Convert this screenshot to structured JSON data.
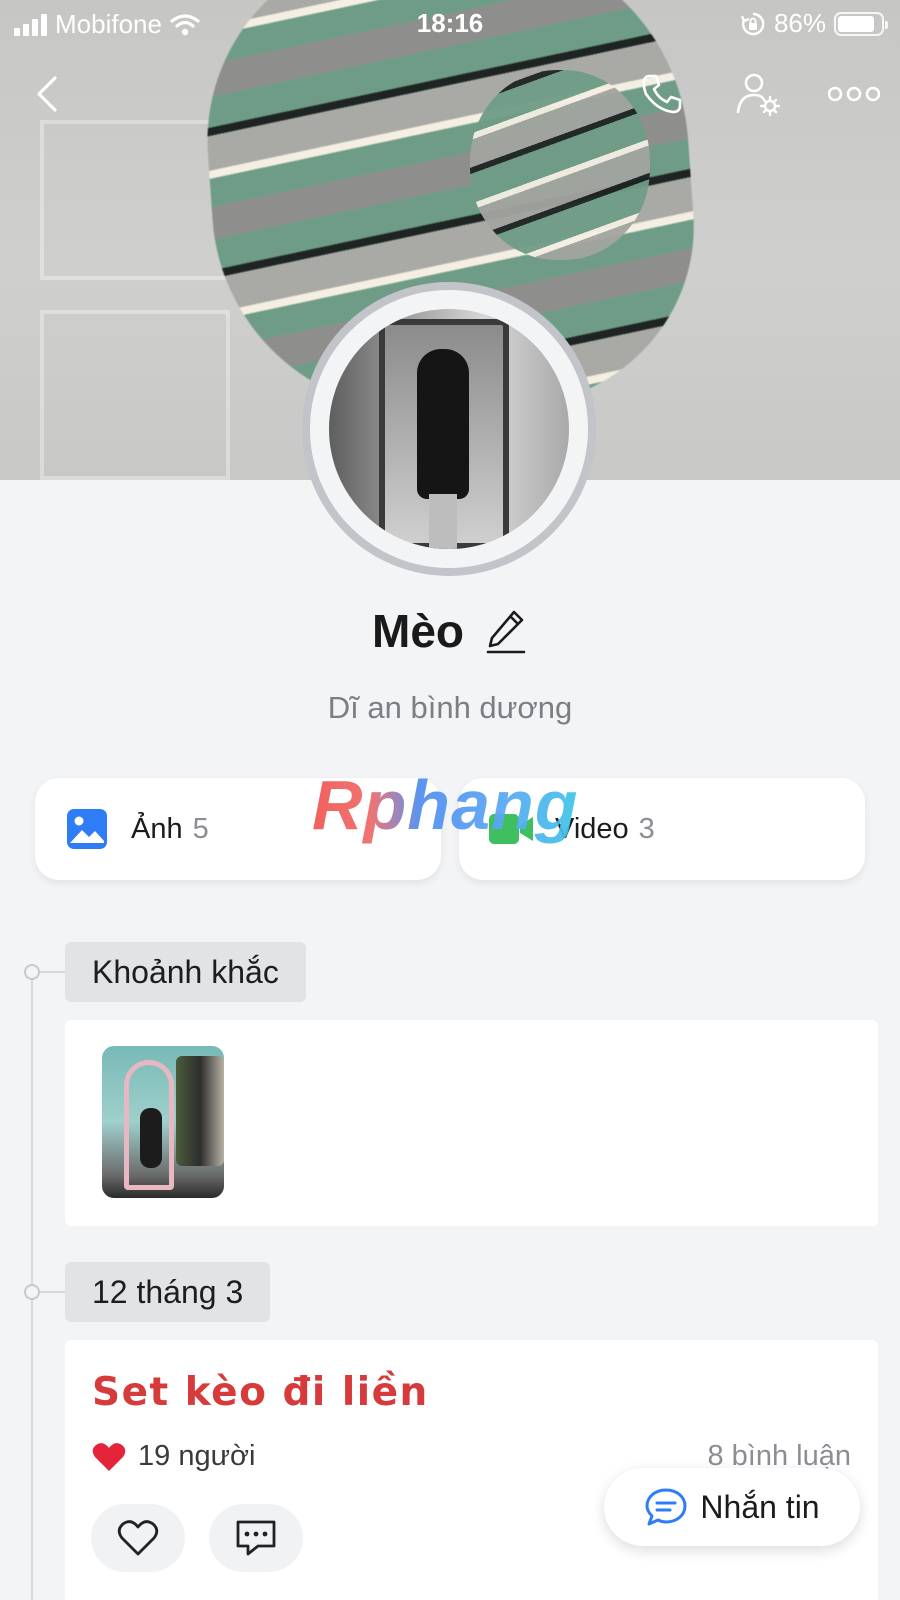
{
  "status_bar": {
    "carrier": "Mobifone",
    "time": "18:16",
    "battery": "86%",
    "battery_level": 0.86
  },
  "profile": {
    "name": "Mèo",
    "location": "Dĩ an bình dương"
  },
  "media": {
    "photos": {
      "label": "Ảnh",
      "count": "5",
      "icon": "image-icon"
    },
    "videos": {
      "label": "Video",
      "count": "3",
      "icon": "video-camera-icon"
    }
  },
  "watermark": "Rphang",
  "timeline": {
    "moments_label": "Khoảnh khắc",
    "post_date": "12 tháng 3",
    "post": {
      "title": "Set kèo đi liền",
      "likes": "19 người",
      "comments": "8 bình luận"
    }
  },
  "fab": {
    "label": "Nhắn tin"
  },
  "colors": {
    "accent_blue": "#2f7df6",
    "video_green": "#3fbf5f",
    "post_title_red": "#d63a3a",
    "heart_red": "#e3243a"
  }
}
